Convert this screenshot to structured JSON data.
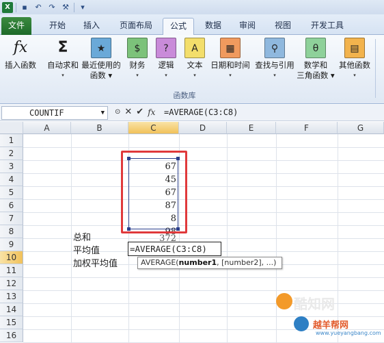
{
  "quick_access": {
    "icons": [
      "excel-icon",
      "save-icon",
      "undo-icon",
      "redo-icon",
      "customize-icon"
    ]
  },
  "tabs": [
    {
      "label": "文件"
    },
    {
      "label": "开始"
    },
    {
      "label": "插入"
    },
    {
      "label": "页面布局"
    },
    {
      "label": "公式"
    },
    {
      "label": "数据"
    },
    {
      "label": "审阅"
    },
    {
      "label": "视图"
    },
    {
      "label": "开发工具"
    }
  ],
  "active_tab": "公式",
  "ribbon": {
    "group_label": "函数库",
    "buttons": [
      {
        "line1": "插入函数",
        "line2": ""
      },
      {
        "line1": "自动求和",
        "line2": "▾"
      },
      {
        "line1": "最近使用的",
        "line2": "函数 ▾"
      },
      {
        "line1": "财务",
        "line2": "▾"
      },
      {
        "line1": "逻辑",
        "line2": "▾"
      },
      {
        "line1": "文本",
        "line2": "▾"
      },
      {
        "line1": "日期和时间",
        "line2": "▾"
      },
      {
        "line1": "查找与引用",
        "line2": "▾"
      },
      {
        "line1": "数学和",
        "line2": "三角函数 ▾"
      },
      {
        "line1": "其他函数",
        "line2": "▾"
      }
    ]
  },
  "formula_bar": {
    "name_box": "COUNTIF",
    "formula": "=AVERAGE(C3:C8)"
  },
  "columns": [
    "A",
    "B",
    "C",
    "D",
    "E",
    "F",
    "G"
  ],
  "rows": [
    "1",
    "2",
    "3",
    "4",
    "5",
    "6",
    "7",
    "8",
    "9",
    "10",
    "11",
    "12",
    "13",
    "14",
    "15",
    "16"
  ],
  "cells": {
    "C3": "67",
    "C4": "45",
    "C5": "67",
    "C6": "87",
    "C7": "8",
    "C8": "98",
    "C9": "372",
    "B9": "总和",
    "B10": "平均值",
    "B11": "加权平均值",
    "C10": "=AVERAGE(C3:C8)"
  },
  "tooltip": {
    "fn": "AVERAGE(",
    "arg1": "number1",
    "rest": ", [number2], ...)"
  },
  "watermark": {
    "line1": "酷知网",
    "line2": "越羊帮网",
    "line3": "www.yueyangbang.com"
  },
  "colors": {
    "file_tab": "#2e7d32",
    "range_border": "#2b3f8c",
    "highlight": "#e0393b"
  }
}
